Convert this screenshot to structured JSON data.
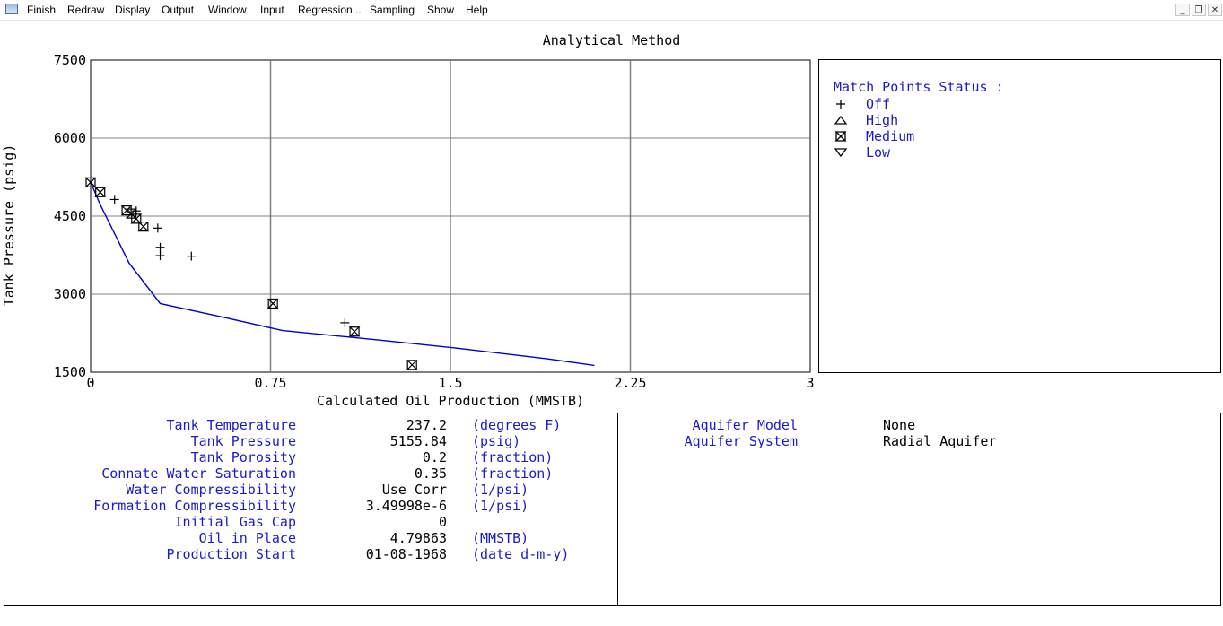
{
  "menu": [
    "Finish",
    "Redraw",
    "Display",
    "Output",
    "Window",
    "Input",
    "Regression...",
    "Sampling",
    "Show",
    "Help"
  ],
  "window_controls": {
    "minimize": "_",
    "restore": "❐",
    "close": "✕"
  },
  "chart_title": "Analytical Method",
  "chart_data": {
    "type": "scatter",
    "title": "Analytical Method",
    "xlabel": "Calculated Oil Production (MMSTB)",
    "ylabel": "Tank Pressure (psig)",
    "xlim": [
      0,
      3
    ],
    "ylim": [
      1500,
      7500
    ],
    "x_ticks": [
      "0",
      "0.75",
      "1.5",
      "2.25",
      "3"
    ],
    "y_ticks": [
      "7500",
      "6000",
      "4500",
      "3000",
      "1500"
    ],
    "grid": true,
    "series": [
      {
        "type": "line",
        "color": "#0000cc",
        "x": [
          0.0,
          0.04,
          0.08,
          0.16,
          0.29,
          0.55,
          0.8,
          1.2,
          1.55,
          1.9,
          2.1
        ],
        "y": [
          5155,
          4720,
          4350,
          3600,
          2820,
          2560,
          2300,
          2120,
          1950,
          1760,
          1630
        ]
      },
      {
        "type": "scatter",
        "status": "off",
        "x": [
          0.1,
          0.19,
          0.28,
          0.29,
          0.29,
          0.42,
          1.06
        ],
        "y": [
          4820,
          4600,
          4270,
          3900,
          3740,
          3730,
          2450
        ]
      },
      {
        "type": "scatter",
        "status": "medium",
        "x": [
          0.0,
          0.04,
          0.15,
          0.17,
          0.19,
          0.22,
          0.76,
          1.1,
          1.34
        ],
        "y": [
          5150,
          4960,
          4610,
          4550,
          4450,
          4300,
          2820,
          2280,
          1640
        ]
      }
    ]
  },
  "legend": {
    "title": "Match Points Status :",
    "items": [
      {
        "symbol": "plus",
        "label": "Off"
      },
      {
        "symbol": "triangle-up",
        "label": "High"
      },
      {
        "symbol": "hourglass",
        "label": "Medium"
      },
      {
        "symbol": "triangle-down",
        "label": "Low"
      }
    ]
  },
  "properties": [
    {
      "label": "Tank Temperature",
      "value": "237.2",
      "unit": "(degrees F)"
    },
    {
      "label": "Tank Pressure",
      "value": "5155.84",
      "unit": "(psig)"
    },
    {
      "label": "Tank Porosity",
      "value": "0.2",
      "unit": "(fraction)"
    },
    {
      "label": "Connate Water Saturation",
      "value": "0.35",
      "unit": "(fraction)"
    },
    {
      "label": "Water Compressibility",
      "value": "Use Corr",
      "unit": "(1/psi)"
    },
    {
      "label": "Formation Compressibility",
      "value": "3.49998e-6",
      "unit": "(1/psi)"
    },
    {
      "label": "Initial Gas Cap",
      "value": "0",
      "unit": ""
    },
    {
      "label": "Oil in Place",
      "value": "4.79863",
      "unit": "(MMSTB)"
    },
    {
      "label": "Production Start",
      "value": "01-08-1968",
      "unit": "(date d-m-y)"
    }
  ],
  "aquifer": [
    {
      "label": "Aquifer Model",
      "value": "None"
    },
    {
      "label": "Aquifer System",
      "value": "Radial Aquifer"
    }
  ],
  "colors": {
    "accent_blue": "#1a1acd",
    "curve": "#0000cc",
    "grid": "#808080"
  }
}
